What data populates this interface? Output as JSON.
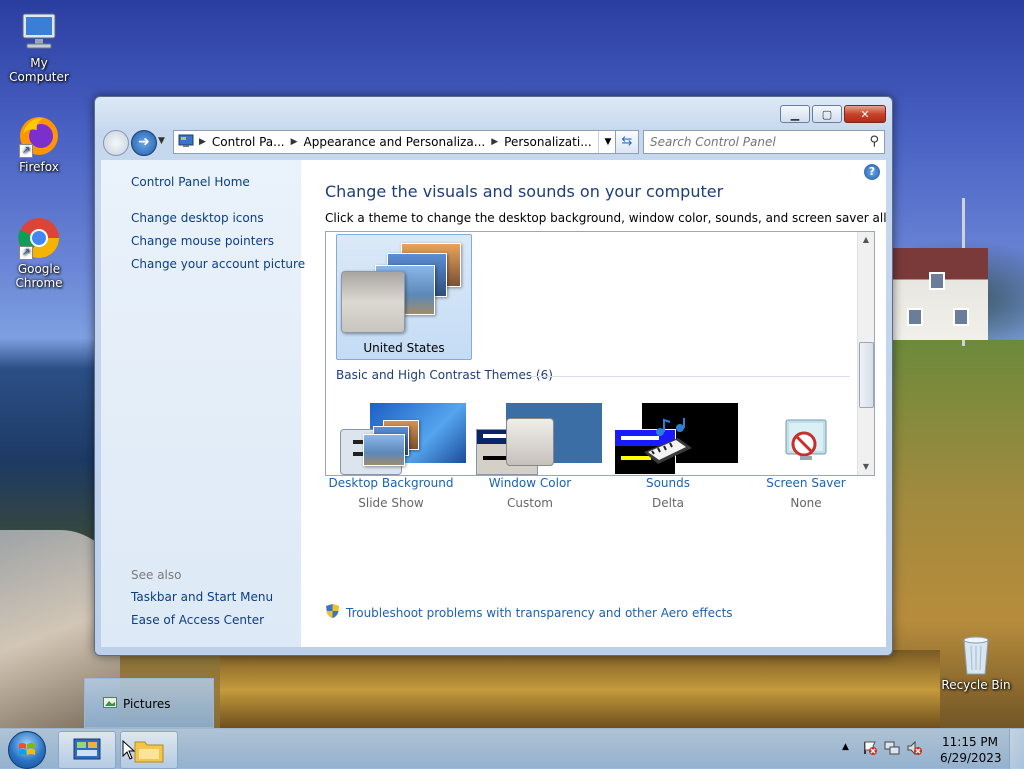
{
  "desktop": {
    "icons": [
      {
        "label": "My Computer"
      },
      {
        "label": "Firefox"
      },
      {
        "label": "Google Chrome"
      },
      {
        "label": "Recycle Bin"
      }
    ]
  },
  "window": {
    "breadcrumbs": [
      "Control Pa...",
      "Appearance and Personaliza...",
      "Personalizati..."
    ],
    "search_placeholder": "Search Control Panel",
    "left_links": [
      "Control Panel Home",
      "Change desktop icons",
      "Change mouse pointers",
      "Change your account picture"
    ],
    "see_also_label": "See also",
    "see_also_links": [
      "Taskbar and Start Menu",
      "Ease of Access Center"
    ],
    "heading": "Change the visuals and sounds on your computer",
    "subtitle": "Click a theme to change the desktop background, window color, sounds, and screen saver all at once.",
    "selected_theme": "United States",
    "basic_group_label": "Basic and High Contrast Themes (6)",
    "items": [
      {
        "label": "Desktop Background",
        "value": "Slide Show"
      },
      {
        "label": "Window Color",
        "value": "Custom"
      },
      {
        "label": "Sounds",
        "value": "Delta"
      },
      {
        "label": "Screen Saver",
        "value": "None"
      }
    ],
    "troubleshoot_link": "Troubleshoot problems with transparency and other Aero effects"
  },
  "taskbar": {
    "tooltip": "Pictures",
    "time": "11:15 PM",
    "date": "6/29/2023"
  }
}
